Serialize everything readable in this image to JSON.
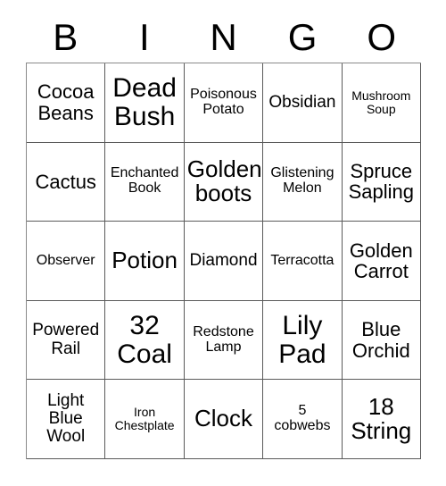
{
  "card": {
    "type": "bingo-card",
    "columns": 5,
    "rows": 5,
    "header": {
      "letters": [
        "B",
        "I",
        "N",
        "G",
        "O"
      ]
    },
    "colors": {
      "background": "#ffffff",
      "text": "#000000",
      "grid_line": "#5a5a5a"
    },
    "cells": [
      {
        "text": "Cocoa\nBeans",
        "size": "lg"
      },
      {
        "text": "Dead\nBush",
        "size": "xxl"
      },
      {
        "text": "Poisonous\nPotato",
        "size": "sm"
      },
      {
        "text": "Obsidian",
        "size": "md"
      },
      {
        "text": "Mushroom\nSoup",
        "size": "xs"
      },
      {
        "text": "Cactus",
        "size": "lg"
      },
      {
        "text": "Enchanted\nBook",
        "size": "sm"
      },
      {
        "text": "Golden\nboots",
        "size": "xl"
      },
      {
        "text": "Glistening\nMelon",
        "size": "sm"
      },
      {
        "text": "Spruce\nSapling",
        "size": "lg"
      },
      {
        "text": "Observer",
        "size": "sm"
      },
      {
        "text": "Potion",
        "size": "xl"
      },
      {
        "text": "Diamond",
        "size": "md"
      },
      {
        "text": "Terracotta",
        "size": "sm"
      },
      {
        "text": "Golden\nCarrot",
        "size": "lg"
      },
      {
        "text": "Powered\nRail",
        "size": "md"
      },
      {
        "text": "32\nCoal",
        "size": "xxl"
      },
      {
        "text": "Redstone\nLamp",
        "size": "sm"
      },
      {
        "text": "Lily\nPad",
        "size": "xxl"
      },
      {
        "text": "Blue\nOrchid",
        "size": "lg"
      },
      {
        "text": "Light\nBlue\nWool",
        "size": "md"
      },
      {
        "text": "Iron\nChestplate",
        "size": "xs"
      },
      {
        "text": "Clock",
        "size": "xl"
      },
      {
        "text": "5\ncobwebs",
        "size": "sm"
      },
      {
        "text": "18\nString",
        "size": "xl"
      }
    ]
  }
}
